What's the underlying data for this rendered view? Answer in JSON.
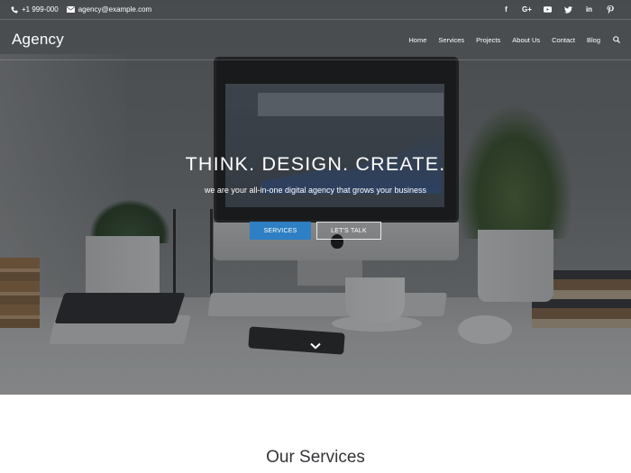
{
  "topbar": {
    "phone": "+1 999-000",
    "email": "agency@example.com",
    "socials": [
      {
        "name": "facebook-icon",
        "glyph": "f"
      },
      {
        "name": "google-plus-icon",
        "glyph": "G+"
      },
      {
        "name": "youtube-icon",
        "glyph": "▶"
      },
      {
        "name": "twitter-icon",
        "glyph": "t"
      },
      {
        "name": "linkedin-icon",
        "glyph": "in"
      },
      {
        "name": "pinterest-icon",
        "glyph": "P"
      }
    ]
  },
  "nav": {
    "logo": "Agency",
    "items": [
      "Home",
      "Services",
      "Projects",
      "About Us",
      "Contact",
      "Blog"
    ]
  },
  "hero": {
    "headline": "THINK. DESIGN. CREATE.",
    "subline": "we are your all-in-one digital agency that grows your business",
    "primary_button": "SERVICES",
    "secondary_button": "LET'S TALK"
  },
  "services": {
    "title": "Our Services"
  },
  "colors": {
    "accent": "#2e7fc3",
    "heading": "#333538"
  }
}
